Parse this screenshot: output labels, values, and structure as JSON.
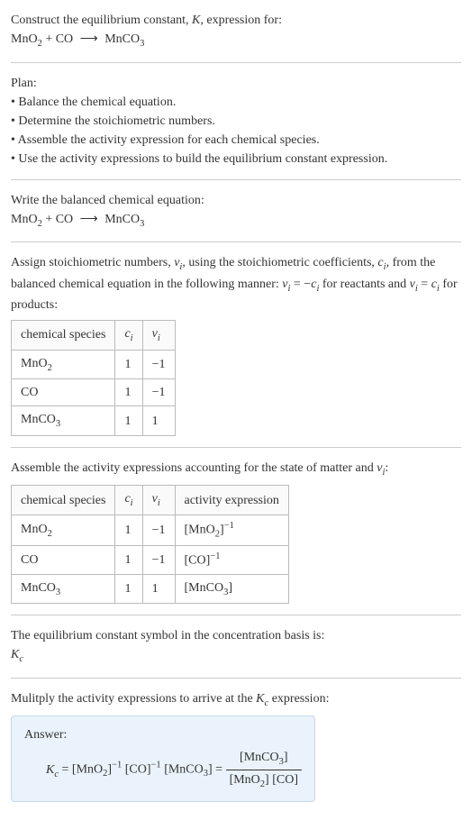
{
  "intro": {
    "line1": "Construct the equilibrium constant, \u0000i\u0000K\u0000/i\u0000, expression for:",
    "equation": "MnO₂2₃ + CO ⟶ MnCO₂3₃"
  },
  "plan": {
    "heading": "Plan:",
    "items": [
      "Balance the chemical equation.",
      "Determine the stoichiometric numbers.",
      "Assemble the activity expression for each chemical species.",
      "Use the activity expressions to build the equilibrium constant expression."
    ]
  },
  "balanced": {
    "heading": "Write the balanced chemical equation:",
    "equation": "MnO₂2₃ + CO ⟶ MnCO₂3₃"
  },
  "assign": {
    "text_prefix": "Assign stoichiometric numbers, ",
    "nu_i": "νₑ",
    "text_mid1": ", using the stoichiometric coefficients, ",
    "c_i": "cₑ",
    "text_mid2": ", from the balanced chemical equation in the following manner: ",
    "rel1": "νₑ = −cₑ",
    "text_mid3": " for reactants and ",
    "rel2": "νₑ = cₑ",
    "text_end": " for products:"
  },
  "table1": {
    "headers": [
      "chemical species",
      "cᵢ",
      "νᵢ"
    ],
    "rows": [
      {
        "species": "MnO₂2₃",
        "c": "1",
        "nu": "−1"
      },
      {
        "species": "CO",
        "c": "1",
        "nu": "−1"
      },
      {
        "species": "MnCO₂3₃",
        "c": "1",
        "nu": "1"
      }
    ]
  },
  "assemble": {
    "text": "Assemble the activity expressions accounting for the state of matter and νᵢ:"
  },
  "table2": {
    "headers": [
      "chemical species",
      "cᵢ",
      "νᵢ",
      "activity expression"
    ],
    "rows": [
      {
        "species": "MnO₂2₃",
        "c": "1",
        "nu": "−1",
        "activity": "[MnO₂2₃]⁻¹"
      },
      {
        "species": "CO",
        "c": "1",
        "nu": "−1",
        "activity": "[CO]⁻¹"
      },
      {
        "species": "MnCO₂3₃",
        "c": "1",
        "nu": "1",
        "activity": "[MnCO₂3₃]"
      }
    ]
  },
  "kc_basis": {
    "text": "The equilibrium constant symbol in the concentration basis is:",
    "symbol": "Kᴄ"
  },
  "multiply": {
    "text": "Mulitply the activity expressions to arrive at the Kᴄ expression:"
  },
  "answer": {
    "label": "Answer:",
    "lhs": "Kᴄ = [MnO₂2₃]⁻¹ [CO]⁻¹ [MnCO₂3₃] =",
    "frac_num": "[MnCO₂3₃]",
    "frac_den": "[MnO₂2₃] [CO]"
  },
  "chart_data": {
    "type": "table",
    "tables": [
      {
        "columns": [
          "chemical species",
          "c_i",
          "nu_i"
        ],
        "rows": [
          [
            "MnO2",
            1,
            -1
          ],
          [
            "CO",
            1,
            -1
          ],
          [
            "MnCO3",
            1,
            1
          ]
        ]
      },
      {
        "columns": [
          "chemical species",
          "c_i",
          "nu_i",
          "activity expression"
        ],
        "rows": [
          [
            "MnO2",
            1,
            -1,
            "[MnO2]^-1"
          ],
          [
            "CO",
            1,
            -1,
            "[CO]^-1"
          ],
          [
            "MnCO3",
            1,
            1,
            "[MnCO3]"
          ]
        ]
      }
    ],
    "equilibrium_constant": "Kc = [MnCO3] / ([MnO2][CO])"
  }
}
